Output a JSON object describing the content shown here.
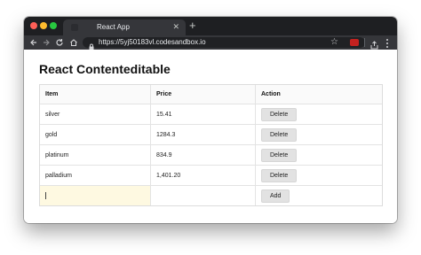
{
  "browser": {
    "tab_title": "React App",
    "tab_close": "✕",
    "new_tab": "+",
    "url": "https://5yj50183vl.codesandbox.io"
  },
  "page": {
    "title": "React Contenteditable"
  },
  "table": {
    "headers": [
      "Item",
      "Price",
      "Action"
    ],
    "rows": [
      {
        "item": "silver",
        "price": "15.41",
        "action": "Delete"
      },
      {
        "item": "gold",
        "price": "1284.3",
        "action": "Delete"
      },
      {
        "item": "platinum",
        "price": "834.9",
        "action": "Delete"
      },
      {
        "item": "palladium",
        "price": "1,401.20",
        "action": "Delete"
      }
    ],
    "new_row": {
      "item": "",
      "price": "",
      "action": "Add"
    }
  },
  "colors": {
    "accent_highlight": "#fef9e1",
    "button_bg": "#e2e2e2",
    "titlebar": "#1e1f22",
    "toolbar": "#35363a"
  }
}
